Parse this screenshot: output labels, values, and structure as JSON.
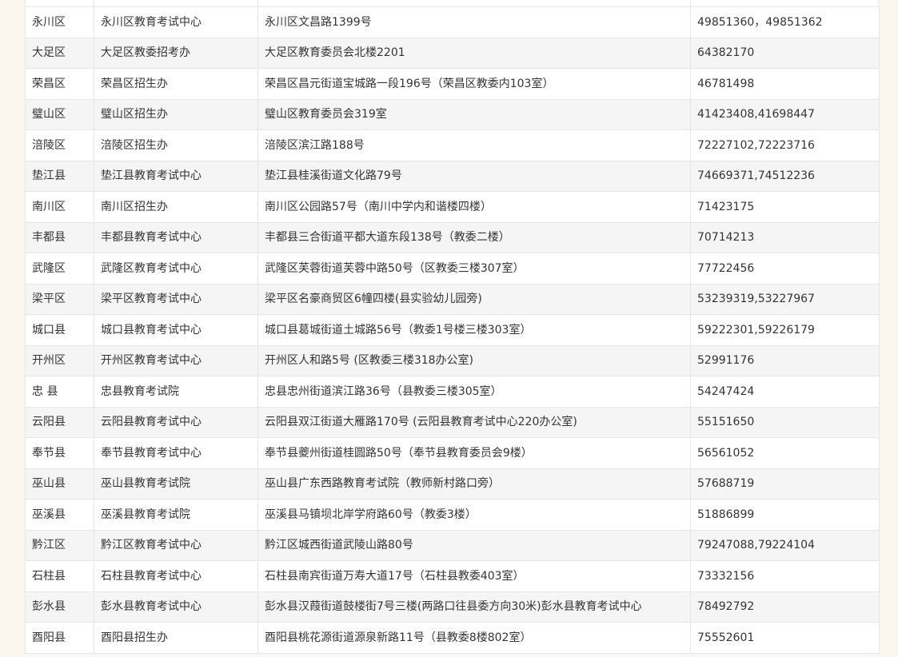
{
  "table": {
    "rows": [
      {
        "district": "永川区",
        "org": "永川区教育考试中心",
        "address": "永川区文昌路1399号",
        "phone": "49851360，49851362"
      },
      {
        "district": "大足区",
        "org": "大足区教委招考办",
        "address": "大足区教育委员会北楼2201",
        "phone": "64382170"
      },
      {
        "district": "荣昌区",
        "org": "荣昌区招生办",
        "address": "荣昌区昌元街道宝城路一段196号（荣昌区教委内103室）",
        "phone": "46781498"
      },
      {
        "district": "璧山区",
        "org": "璧山区招生办",
        "address": "璧山区教育委员会319室",
        "phone": "41423408,41698447"
      },
      {
        "district": "涪陵区",
        "org": "涪陵区招生办",
        "address": "涪陵区滨江路188号",
        "phone": "72227102,72223716"
      },
      {
        "district": "垫江县",
        "org": "垫江县教育考试中心",
        "address": "垫江县桂溪街道文化路79号",
        "phone": "74669371,74512236"
      },
      {
        "district": "南川区",
        "org": "南川区招生办",
        "address": "南川区公园路57号（南川中学内和谐楼四楼）",
        "phone": "71423175"
      },
      {
        "district": "丰都县",
        "org": "丰都县教育考试中心",
        "address": "丰都县三合街道平都大道东段138号（教委二楼）",
        "phone": "70714213"
      },
      {
        "district": "武隆区",
        "org": "武隆区教育考试中心",
        "address": "武隆区芙蓉街道芙蓉中路50号（区教委三楼307室）",
        "phone": "77722456"
      },
      {
        "district": "梁平区",
        "org": "梁平区教育考试中心",
        "address": "梁平区名豪商贸区6幢四楼(县实验幼儿园旁)",
        "phone": "53239319,53227967"
      },
      {
        "district": "城口县",
        "org": "城口县教育考试中心",
        "address": "城口县葛城街道土城路56号（教委1号楼三楼303室）",
        "phone": "59222301,59226179"
      },
      {
        "district": "开州区",
        "org": "开州区教育考试中心",
        "address": "开州区人和路5号 (区教委三楼318办公室)",
        "phone": "52991176"
      },
      {
        "district": "忠 县",
        "org": "忠县教育考试院",
        "address": "忠县忠州街道滨江路36号（县教委三楼305室）",
        "phone": "54247424"
      },
      {
        "district": "云阳县",
        "org": "云阳县教育考试中心",
        "address": "云阳县双江街道大雁路170号 (云阳县教育考试中心220办公室)",
        "phone": "55151650"
      },
      {
        "district": "奉节县",
        "org": "奉节县教育考试中心",
        "address": "奉节县夔州街道桂圆路50号（奉节县教育委员会9楼）",
        "phone": "56561052"
      },
      {
        "district": "巫山县",
        "org": "巫山县教育考试院",
        "address": "巫山县广东西路教育考试院（教师新村路口旁）",
        "phone": "57688719"
      },
      {
        "district": "巫溪县",
        "org": "巫溪县教育考试院",
        "address": "巫溪县马镇坝北岸学府路60号（教委3楼）",
        "phone": "51886899"
      },
      {
        "district": "黔江区",
        "org": "黔江区教育考试中心",
        "address": "黔江区城西街道武陵山路80号",
        "phone": "79247088,79224104"
      },
      {
        "district": "石柱县",
        "org": "石柱县教育考试中心",
        "address": "石柱县南宾街道万寿大道17号（石柱县教委403室）",
        "phone": "73332156"
      },
      {
        "district": "彭水县",
        "org": "彭水县教育考试中心",
        "address": "彭水县汉葭街道鼓楼街7号三楼(两路口往县委方向30米)彭水县教育考试中心",
        "phone": "78492792"
      },
      {
        "district": "酉阳县",
        "org": "酉阳县招生办",
        "address": "酉阳县桃花源街道源泉新路11号（县教委8楼802室）",
        "phone": "75552601"
      }
    ]
  }
}
